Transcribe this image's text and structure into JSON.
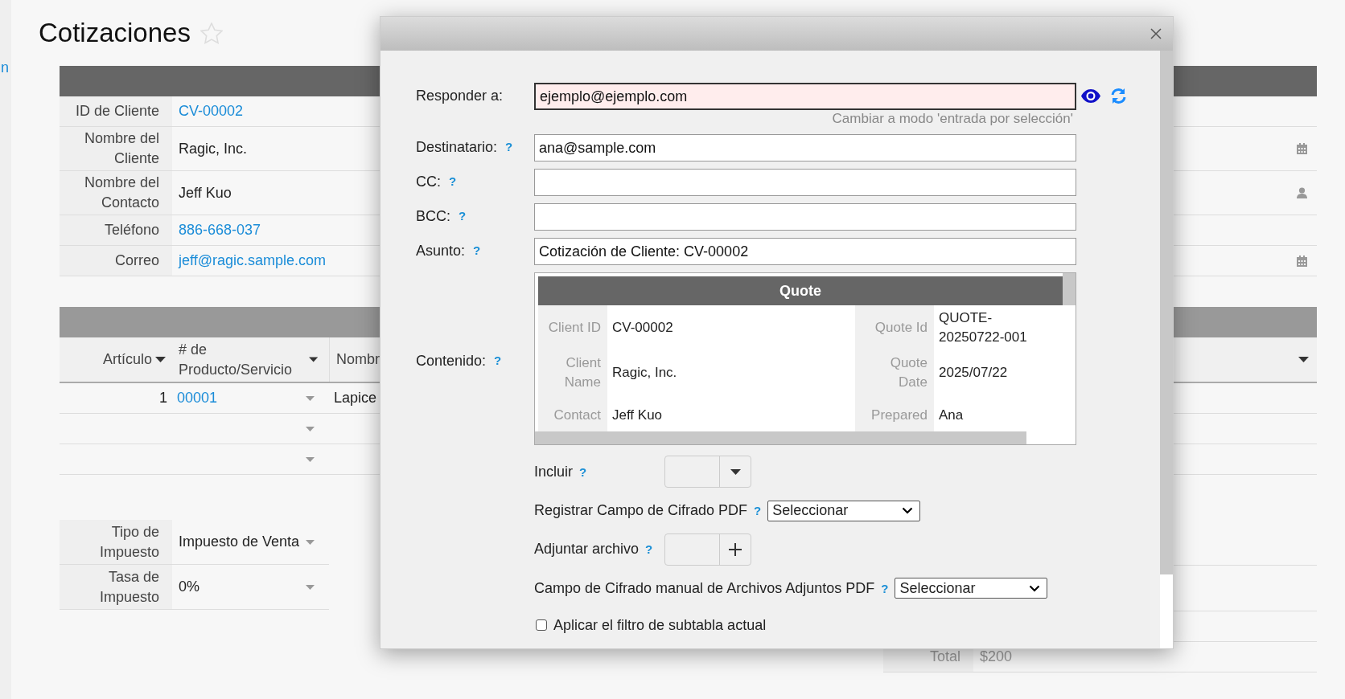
{
  "sidebar": {
    "link": "n"
  },
  "page": {
    "title": "Cotizaciones",
    "starred": false
  },
  "form": {
    "fields": [
      {
        "label": "ID de Cliente",
        "value": "CV-00002",
        "kind": "link"
      },
      {
        "label": "Nombre del Cliente",
        "value": "Ragic, Inc.",
        "kind": "text"
      },
      {
        "label": "Nombre del Contacto",
        "value": "Jeff Kuo",
        "kind": "text"
      },
      {
        "label": "Teléfono",
        "value": "886-668-037",
        "kind": "link"
      },
      {
        "label": "Correo",
        "value": "jeff@ragic.sample.com",
        "kind": "link"
      }
    ]
  },
  "subtable": {
    "columns": [
      {
        "label": "Artículo"
      },
      {
        "label": "# de Producto/Servicio"
      },
      {
        "label": "Nombr"
      }
    ],
    "rows": [
      {
        "column_1": "1",
        "column_2": "00001",
        "column_3": "Lapice"
      },
      {},
      {}
    ]
  },
  "tax": [
    {
      "label": "Tipo de Impuesto",
      "value": "Impuesto de Venta"
    },
    {
      "label": "Tasa de Impuesto",
      "value": "0%"
    }
  ],
  "total": {
    "label": "Total",
    "value": "$200"
  },
  "dialog": {
    "fields": [
      {
        "label": "Responder a:",
        "value": "ejemplo@ejemplo.com",
        "invalid": true,
        "hint": "Cambiar a modo 'entrada por selección'"
      },
      {
        "label": "Destinatario:",
        "help": "?",
        "value": "ana@sample.com",
        "invalid": false
      },
      {
        "label": "CC:",
        "help": "?",
        "invalid": false
      },
      {
        "label": "BCC:",
        "help": "?",
        "invalid": false
      },
      {
        "label": "Asunto:",
        "help": "?",
        "value": "Cotización de Cliente: CV-00002",
        "invalid": false
      }
    ],
    "content": {
      "label": "Contenido:",
      "help": "?",
      "preview": {
        "title": "Quote",
        "rows": [
          {
            "label_1": "Client ID",
            "value_1": "CV-00002",
            "label_2": "Quote Id",
            "value_2": "QUOTE-20250722-001"
          },
          {
            "label_1": "Client Name",
            "value_1": "Ragic, Inc.",
            "label_2": "Quote Date",
            "value_2": "2025/07/22"
          },
          {
            "label_1": "Contact",
            "value_1": "Jeff Kuo",
            "label_2": "Prepared",
            "value_2": "Ana"
          }
        ]
      }
    },
    "options": [
      {
        "kind": "picker",
        "label": "Incluir",
        "help": "?"
      },
      {
        "kind": "select",
        "label": "Registrar Campo de Cifrado PDF",
        "help": "?",
        "value": "Seleccionar"
      },
      {
        "kind": "upload",
        "label": "Adjuntar archivo",
        "help": "?"
      },
      {
        "kind": "select",
        "label": "Campo de Cifrado manual de Archivos Adjuntos PDF",
        "help": "?",
        "value": "Seleccionar"
      },
      {
        "kind": "checkbox",
        "label": "Aplicar el filtro de subtabla actual",
        "checked": false
      }
    ]
  }
}
